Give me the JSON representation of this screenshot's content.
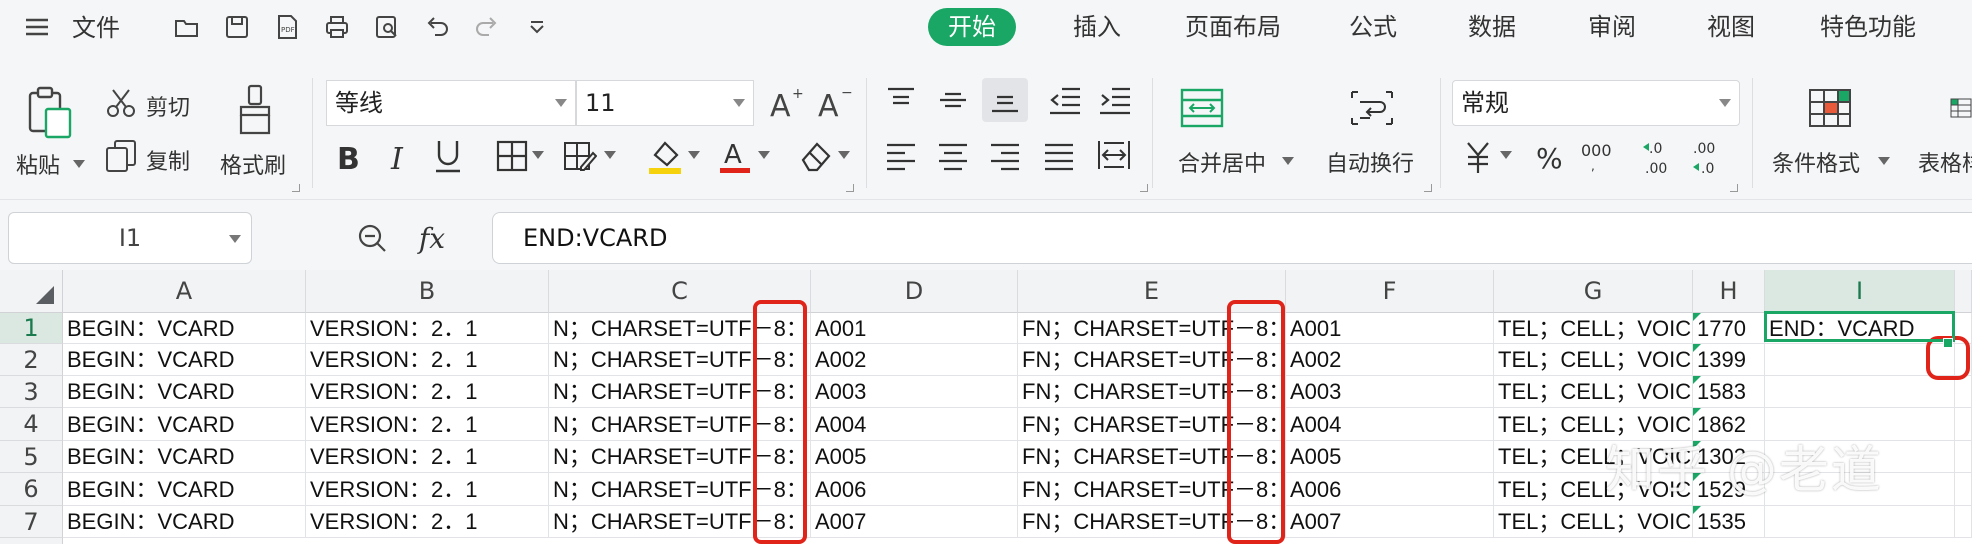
{
  "menubar": {
    "file_label": "文件",
    "tabs": [
      {
        "label": "开始",
        "active": true
      },
      {
        "label": "插入"
      },
      {
        "label": "页面布局"
      },
      {
        "label": "公式"
      },
      {
        "label": "数据"
      },
      {
        "label": "审阅"
      },
      {
        "label": "视图"
      },
      {
        "label": "特色功能"
      }
    ],
    "accent_color": "#1aa766"
  },
  "ribbon": {
    "paste_label": "粘贴",
    "cut_label": "剪切",
    "copy_label": "复制",
    "format_painter_label": "格式刷",
    "font_name": "等线",
    "font_size": "11",
    "merge_center_label": "合并居中",
    "wrap_text_label": "自动换行",
    "number_format": "常规",
    "conditional_format_label": "条件格式",
    "table_style_label": "表格样"
  },
  "formula_bar": {
    "name_box": "I1",
    "fx_label": "fx",
    "formula": "END:VCARD"
  },
  "sheet": {
    "columns": [
      "A",
      "B",
      "C",
      "D",
      "E",
      "F",
      "G",
      "H",
      "I"
    ],
    "rows": [
      "1",
      "2",
      "3",
      "4",
      "5",
      "6",
      "7"
    ],
    "cells": [
      [
        "BEGIN：VCARD",
        "VERSION：2．1",
        "N；CHARSET=UTF－8：",
        "A001",
        "FN；CHARSET=UTF－8：",
        "A001",
        "TEL；CELL；VOICE：",
        "1770",
        "END：VCARD"
      ],
      [
        "BEGIN：VCARD",
        "VERSION：2．1",
        "N；CHARSET=UTF－8：",
        "A002",
        "FN；CHARSET=UTF－8：",
        "A002",
        "TEL；CELL；VOICE：",
        "1399",
        ""
      ],
      [
        "BEGIN：VCARD",
        "VERSION：2．1",
        "N；CHARSET=UTF－8：",
        "A003",
        "FN；CHARSET=UTF－8：",
        "A003",
        "TEL；CELL；VOICE：",
        "1583",
        ""
      ],
      [
        "BEGIN：VCARD",
        "VERSION：2．1",
        "N；CHARSET=UTF－8：",
        "A004",
        "FN；CHARSET=UTF－8：",
        "A004",
        "TEL；CELL；VOICE：",
        "1862",
        ""
      ],
      [
        "BEGIN：VCARD",
        "VERSION：2．1",
        "N；CHARSET=UTF－8：",
        "A005",
        "FN；CHARSET=UTF－8：",
        "A005",
        "TEL；CELL；VOICE：",
        "1302",
        ""
      ],
      [
        "BEGIN：VCARD",
        "VERSION：2．1",
        "N；CHARSET=UTF－8：",
        "A006",
        "FN；CHARSET=UTF－8：",
        "A006",
        "TEL；CELL；VOICE：",
        "1529",
        ""
      ],
      [
        "BEGIN：VCARD",
        "VERSION：2．1",
        "N；CHARSET=UTF－8：",
        "A007",
        "FN；CHARSET=UTF－8：",
        "A007",
        "TEL；CELL；VOICE：",
        "1535",
        ""
      ]
    ],
    "selected_cell": "I1",
    "highlight_color": "#e0241a",
    "watermark": "知乎 @老道"
  }
}
